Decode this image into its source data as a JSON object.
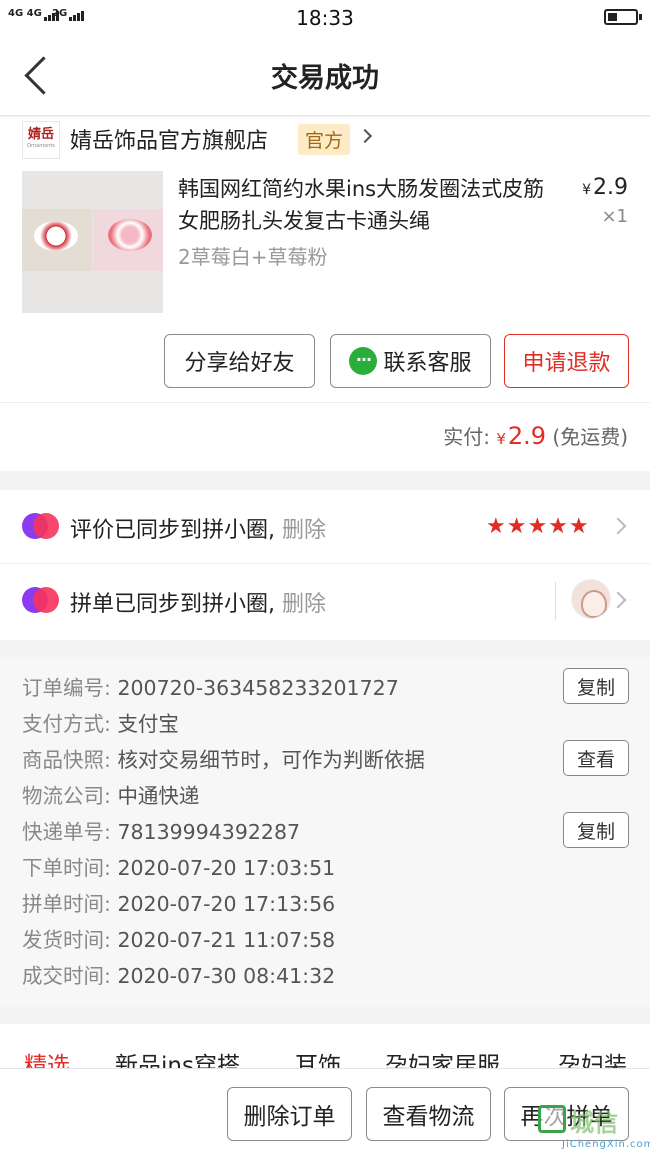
{
  "status_bar": {
    "network_1": "4G 4G",
    "network_2": "2G",
    "time": "18:33",
    "battery_level": 0.35
  },
  "nav": {
    "title": "交易成功",
    "back_icon": "chevron-left-icon"
  },
  "shop": {
    "logo_mark": "婧岳",
    "logo_sub": "Ornaments",
    "name": "婧岳饰品官方旗舰店",
    "badge": "官方"
  },
  "product": {
    "title": "韩国网红简约水果ins大肠发圈法式皮筋女肥肠扎头发复古卡通头绳",
    "price_symbol": "¥",
    "price": "2.9",
    "quantity": "×1",
    "variant": "2草莓白+草莓粉"
  },
  "actions": {
    "share": "分享给好友",
    "service": "联系客服",
    "refund": "申请退款"
  },
  "payment": {
    "label": "实付: ",
    "symbol": "¥",
    "amount": "2.9",
    "note": " (免运费)"
  },
  "sync": {
    "review_text": "评价已同步到拼小圈, ",
    "review_delete": "删除",
    "rating": "★★★★★",
    "group_text": "拼单已同步到拼小圈, ",
    "group_delete": "删除"
  },
  "order_info": [
    {
      "label": "订单编号: ",
      "value": "200720-363458233201727",
      "button": "复制"
    },
    {
      "label": "支付方式: ",
      "value": "支付宝",
      "button": ""
    },
    {
      "label": "商品快照: ",
      "value": "核对交易细节时，可作为判断依据",
      "button": "查看"
    },
    {
      "label": "物流公司: ",
      "value": "中通快递",
      "button": ""
    },
    {
      "label": "快递单号: ",
      "value": "78139994392287",
      "button": "复制"
    },
    {
      "label": "下单时间: ",
      "value": "2020-07-20 17:03:51",
      "button": ""
    },
    {
      "label": "拼单时间: ",
      "value": "2020-07-20 17:13:56",
      "button": ""
    },
    {
      "label": "发货时间: ",
      "value": "2020-07-21 11:07:58",
      "button": ""
    },
    {
      "label": "成交时间: ",
      "value": "2020-07-30 08:41:32",
      "button": ""
    }
  ],
  "categories": [
    "精选",
    "新品ins穿搭",
    "耳饰",
    "孕妇家居服",
    "孕妇装"
  ],
  "bottom_actions": {
    "delete": "删除订单",
    "logistics": "查看物流",
    "reorder": "再次拼单"
  },
  "watermark": {
    "text": "城信",
    "sub": "JiChengXin.com"
  },
  "colors": {
    "accent_red": "#e02e24",
    "badge_bg": "#fcebc6",
    "wechat_green": "#2aae3b"
  }
}
